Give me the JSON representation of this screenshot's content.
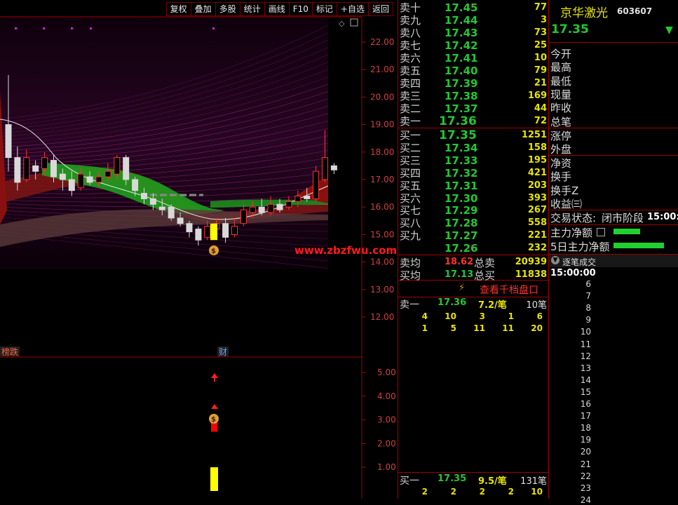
{
  "toolbar": [
    "复权",
    "叠加",
    "多股",
    "统计",
    "画线",
    "F10",
    "标记",
    "+自选",
    "返回"
  ],
  "chart": {
    "price_ticks": [
      "22.00",
      "21.00",
      "20.00",
      "19.00",
      "18.00",
      "17.00",
      "16.00",
      "15.00",
      "14.00",
      "13.00",
      "12.00"
    ],
    "indicator_ticks": [
      "5.00",
      "4.00",
      "3.00",
      "2.00",
      "1.00"
    ],
    "bottom_labels": {
      "left": "榜跌",
      "mid": "财"
    },
    "watermark": "www.zbzfwu.com",
    "money_icon": "$"
  },
  "chart_data": [
    {
      "type": "candlestick",
      "yrange": [
        11.5,
        22.5
      ],
      "candles": [
        {
          "o": 19.0,
          "c": 17.8,
          "h": 20.8,
          "l": 17.3
        },
        {
          "o": 17.8,
          "c": 16.9,
          "h": 18.2,
          "l": 16.6
        },
        {
          "o": 17.0,
          "c": 17.8,
          "h": 18.1,
          "l": 16.9
        },
        {
          "o": 17.5,
          "c": 17.3,
          "h": 17.7,
          "l": 17.0
        },
        {
          "o": 17.4,
          "c": 17.8,
          "h": 18.0,
          "l": 17.2
        },
        {
          "o": 17.7,
          "c": 17.1,
          "h": 17.9,
          "l": 16.9
        },
        {
          "o": 17.2,
          "c": 17.0,
          "h": 17.4,
          "l": 16.6
        },
        {
          "o": 17.0,
          "c": 16.6,
          "h": 17.3,
          "l": 16.4
        },
        {
          "o": 16.7,
          "c": 17.2,
          "h": 17.4,
          "l": 16.6
        },
        {
          "o": 17.1,
          "c": 16.9,
          "h": 17.3,
          "l": 16.8
        },
        {
          "o": 16.9,
          "c": 17.1,
          "h": 17.3,
          "l": 16.7
        },
        {
          "o": 17.1,
          "c": 17.3,
          "h": 17.6,
          "l": 16.9
        },
        {
          "o": 17.2,
          "c": 17.8,
          "h": 17.9,
          "l": 17.0
        },
        {
          "o": 17.8,
          "c": 17.0,
          "h": 17.9,
          "l": 16.8
        },
        {
          "o": 17.0,
          "c": 16.6,
          "h": 17.1,
          "l": 16.4
        },
        {
          "o": 16.5,
          "c": 16.3,
          "h": 16.7,
          "l": 16.1
        },
        {
          "o": 16.3,
          "c": 16.1,
          "h": 16.5,
          "l": 15.9
        },
        {
          "o": 16.0,
          "c": 15.9,
          "h": 16.3,
          "l": 15.7
        },
        {
          "o": 16.0,
          "c": 15.6,
          "h": 16.1,
          "l": 15.5
        },
        {
          "o": 15.6,
          "c": 15.4,
          "h": 15.8,
          "l": 15.3
        },
        {
          "o": 15.4,
          "c": 15.1,
          "h": 15.5,
          "l": 14.9
        },
        {
          "o": 15.2,
          "c": 14.8,
          "h": 15.3,
          "l": 14.6
        },
        {
          "o": 14.9,
          "c": 15.3,
          "h": 15.5,
          "l": 14.8
        },
        {
          "o": 15.2,
          "c": 15.4,
          "h": 15.6,
          "l": 15.0
        },
        {
          "o": 15.4,
          "c": 14.9,
          "h": 15.6,
          "l": 14.7
        },
        {
          "o": 15.0,
          "c": 15.3,
          "h": 15.6,
          "l": 14.9
        },
        {
          "o": 15.4,
          "c": 15.9,
          "h": 16.1,
          "l": 15.3
        },
        {
          "o": 15.8,
          "c": 16.0,
          "h": 16.2,
          "l": 15.6
        },
        {
          "o": 16.0,
          "c": 15.8,
          "h": 16.3,
          "l": 15.7
        },
        {
          "o": 15.8,
          "c": 16.1,
          "h": 16.4,
          "l": 15.7
        },
        {
          "o": 16.1,
          "c": 15.9,
          "h": 16.3,
          "l": 15.8
        },
        {
          "o": 16.0,
          "c": 16.2,
          "h": 16.4,
          "l": 15.9
        },
        {
          "o": 16.2,
          "c": 16.4,
          "h": 16.6,
          "l": 16.0
        },
        {
          "o": 16.4,
          "c": 16.3,
          "h": 16.7,
          "l": 16.2
        },
        {
          "o": 16.3,
          "c": 17.3,
          "h": 17.5,
          "l": 16.2
        },
        {
          "o": 17.0,
          "c": 17.8,
          "h": 18.8,
          "l": 16.9
        },
        {
          "o": 17.5,
          "c": 17.35,
          "h": 17.6,
          "l": 17.2
        }
      ]
    },
    {
      "type": "bar",
      "yrange": [
        0,
        5.5
      ],
      "bars": [
        {
          "index": 21,
          "value": 1.0,
          "color": "#ffff00"
        },
        {
          "index": 21,
          "value": 2.95,
          "color": "#ff0000"
        }
      ]
    }
  ],
  "orderbook": {
    "sell": [
      {
        "label": "卖十",
        "price": "17.45",
        "vol": "77",
        "mark": "*"
      },
      {
        "label": "卖九",
        "price": "17.44",
        "vol": "3"
      },
      {
        "label": "卖八",
        "price": "17.43",
        "vol": "73"
      },
      {
        "label": "卖七",
        "price": "17.42",
        "vol": "25"
      },
      {
        "label": "卖六",
        "price": "17.41",
        "vol": "10"
      },
      {
        "label": "卖五",
        "price": "17.40",
        "vol": "79"
      },
      {
        "label": "卖四",
        "price": "17.39",
        "vol": "21"
      },
      {
        "label": "卖三",
        "price": "17.38",
        "vol": "169"
      },
      {
        "label": "卖二",
        "price": "17.37",
        "vol": "44"
      },
      {
        "label": "卖一",
        "price": "17.36",
        "vol": "72"
      }
    ],
    "buy": [
      {
        "label": "买一",
        "price": "17.35",
        "vol": "1251"
      },
      {
        "label": "买二",
        "price": "17.34",
        "vol": "158"
      },
      {
        "label": "买三",
        "price": "17.33",
        "vol": "195"
      },
      {
        "label": "买四",
        "price": "17.32",
        "vol": "421"
      },
      {
        "label": "买五",
        "price": "17.31",
        "vol": "203"
      },
      {
        "label": "买六",
        "price": "17.30",
        "vol": "393"
      },
      {
        "label": "买七",
        "price": "17.29",
        "vol": "267"
      },
      {
        "label": "买八",
        "price": "17.28",
        "vol": "558"
      },
      {
        "label": "买九",
        "price": "17.27",
        "vol": "221"
      },
      {
        "label": "",
        "price": "17.26",
        "vol": "232",
        "mark": "*"
      }
    ],
    "summary": {
      "sell_avg_label": "卖均",
      "sell_avg": "18.62",
      "total_sell_label": "总卖",
      "total_sell": "20939",
      "buy_avg_label": "买均",
      "buy_avg": "17.13",
      "total_buy_label": "总买",
      "total_buy": "11838"
    }
  },
  "bigorder": {
    "link": "查看千档盘口",
    "sell1": {
      "label": "卖一",
      "price": "17.36",
      "avg": "7.2/笔",
      "count": "10笔"
    },
    "sell_rows": [
      [
        "4",
        "10",
        "3",
        "1",
        "6"
      ],
      [
        "1",
        "5",
        "11",
        "11",
        "20"
      ]
    ],
    "buy1": {
      "label": "买一",
      "price": "17.35",
      "avg": "9.5/笔",
      "count": "131笔"
    },
    "buy_rows": [
      [
        "2",
        "2",
        "2",
        "2",
        "10"
      ]
    ]
  },
  "info": {
    "name": "京华激光",
    "code": "603607",
    "price": "17.35",
    "arrow": "▼",
    "labels": [
      "今开",
      "最高",
      "最低",
      "现量",
      "昨收",
      "总笔"
    ],
    "labels2": [
      "涨停",
      "外盘"
    ],
    "labels3": [
      "净资",
      "换手",
      "换手Z",
      "收益㈢"
    ],
    "status_label": "交易状态:",
    "status": "闭市阶段",
    "status_time": "15:00:0",
    "main_net": "主力净额",
    "main_net5": "5日主力净额",
    "ticks_title": "逐笔成交",
    "ticks_time": "15:00:00",
    "ticks": [
      "6",
      "7",
      "8",
      "9",
      "10",
      "11",
      "12",
      "13",
      "14",
      "15",
      "16",
      "17",
      "18",
      "19",
      "20",
      "21",
      "22",
      "23",
      "24"
    ]
  },
  "colors": {
    "up": "#ff3232",
    "down": "#54ffff",
    "green": "#21c832",
    "yellow": "#e8e400",
    "frame": "#a00000"
  }
}
